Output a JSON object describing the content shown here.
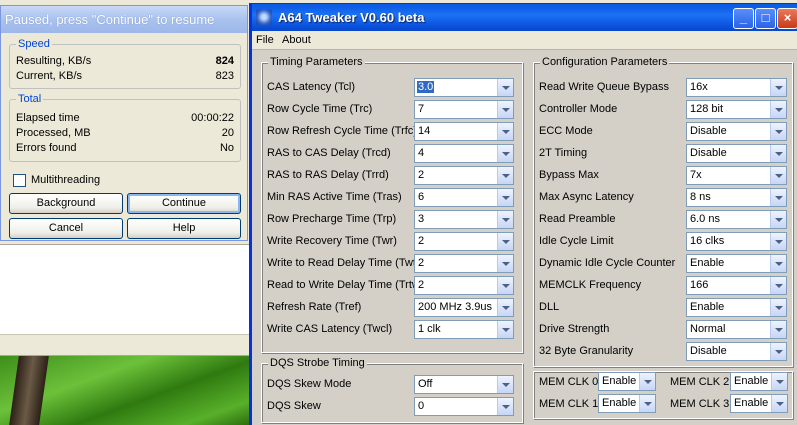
{
  "progress_dialog": {
    "title": "Paused, press \"Continue\" to resume",
    "speed": {
      "legend": "Speed",
      "resulting_label": "Resulting, KB/s",
      "resulting_value": "824",
      "current_label": "Current, KB/s",
      "current_value": "823"
    },
    "total": {
      "legend": "Total",
      "elapsed_label": "Elapsed time",
      "elapsed_value": "00:00:22",
      "processed_label": "Processed, MB",
      "processed_value": "20",
      "errors_label": "Errors found",
      "errors_value": "No"
    },
    "multithreading_label": "Multithreading",
    "multithreading_checked": false,
    "buttons": {
      "background": "Background",
      "continue": "Continue",
      "cancel": "Cancel",
      "help": "Help"
    }
  },
  "tweaker": {
    "title": "A64 Tweaker V0.60 beta",
    "title_buttons": {
      "minimize": "_",
      "maximize": "□",
      "close": "×"
    },
    "menu": [
      "File",
      "About"
    ],
    "timing": {
      "legend": "Timing Parameters",
      "params": [
        {
          "label": "CAS Latency (Tcl)",
          "value": "3.0",
          "selected": true
        },
        {
          "label": "Row Cycle Time (Trc)",
          "value": "7"
        },
        {
          "label": "Row Refresh Cycle Time (Trfc)",
          "value": "14"
        },
        {
          "label": "RAS to CAS Delay (Trcd)",
          "value": "4"
        },
        {
          "label": "RAS to RAS Delay (Trrd)",
          "value": "2"
        },
        {
          "label": "Min RAS Active Time (Tras)",
          "value": "6"
        },
        {
          "label": "Row Precharge Time (Trp)",
          "value": "3"
        },
        {
          "label": "Write Recovery Time (Twr)",
          "value": "2"
        },
        {
          "label": "Write to Read Delay Time (Twtr)",
          "value": "2"
        },
        {
          "label": "Read to Write Delay Time (Trtw)",
          "value": "2"
        },
        {
          "label": "Refresh Rate (Tref)",
          "value": "200 MHz 3.9us"
        },
        {
          "label": "Write CAS Latency (Twcl)",
          "value": "1 clk"
        }
      ]
    },
    "dqs": {
      "legend": "DQS Strobe Timing",
      "params": [
        {
          "label": "DQS Skew Mode",
          "value": "Off"
        },
        {
          "label": "DQS Skew",
          "value": "0"
        }
      ]
    },
    "config": {
      "legend": "Configuration Parameters",
      "params": [
        {
          "label": "Read Write Queue Bypass",
          "value": "16x"
        },
        {
          "label": "Controller Mode",
          "value": "128 bit"
        },
        {
          "label": "ECC Mode",
          "value": "Disable"
        },
        {
          "label": "2T Timing",
          "value": "Disable"
        },
        {
          "label": "Bypass Max",
          "value": "7x"
        },
        {
          "label": "Max Async Latency",
          "value": "8 ns"
        },
        {
          "label": "Read Preamble",
          "value": "6.0 ns"
        },
        {
          "label": "Idle Cycle Limit",
          "value": "16 clks"
        },
        {
          "label": "Dynamic Idle Cycle Counter",
          "value": "Enable"
        },
        {
          "label": "MEMCLK Frequency",
          "value": "166"
        },
        {
          "label": "DLL",
          "value": "Enable"
        },
        {
          "label": "Drive Strength",
          "value": "Normal"
        },
        {
          "label": "32 Byte Granularity",
          "value": "Disable"
        }
      ]
    },
    "memclk": [
      {
        "label": "MEM CLK 0",
        "value": "Enable"
      },
      {
        "label": "MEM CLK 2",
        "value": "Enable"
      },
      {
        "label": "MEM CLK 1",
        "value": "Enable"
      },
      {
        "label": "MEM CLK 3",
        "value": "Enable"
      }
    ]
  }
}
